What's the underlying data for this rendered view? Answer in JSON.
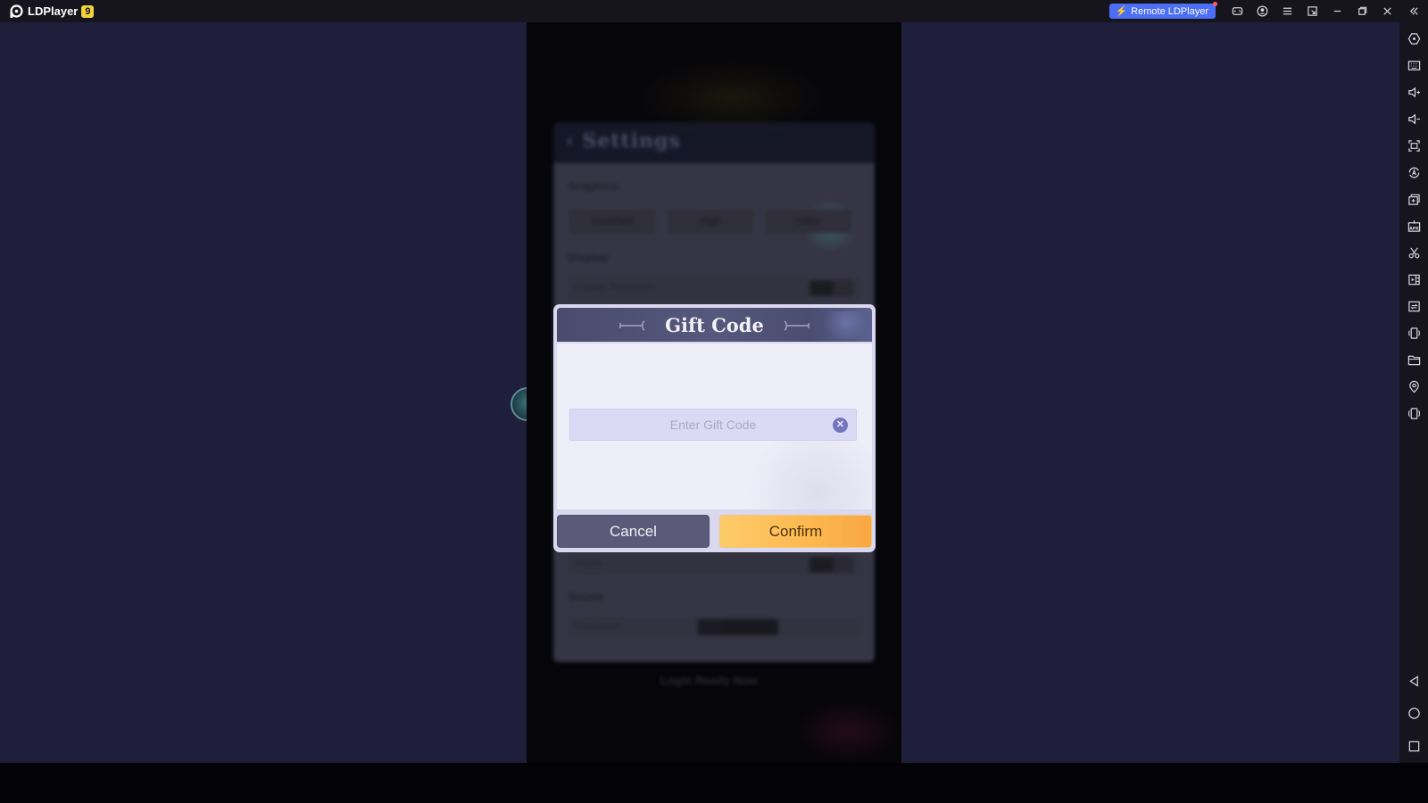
{
  "titlebar": {
    "app_name": "LDPlayer",
    "version_badge": "9",
    "remote_button_label": "Remote LDPlayer",
    "icons": [
      "gamepad-icon",
      "account-icon",
      "menu-icon",
      "sync-window-icon",
      "minimize-icon",
      "restore-icon",
      "close-icon",
      "collapse-sidebar-icon"
    ]
  },
  "sidebar": {
    "top_items": [
      {
        "name": "settings-icon",
        "label": "Settings"
      },
      {
        "name": "keyboard-icon",
        "label": "Keyboard mapping"
      },
      {
        "name": "volume-up-icon",
        "label": "Volume up"
      },
      {
        "name": "volume-down-icon",
        "label": "Volume down"
      },
      {
        "name": "screenshot-icon",
        "label": "Screenshot"
      },
      {
        "name": "auto-rotate-icon",
        "label": "Operation recorder"
      },
      {
        "name": "multi-instance-icon",
        "label": "Multi-instance"
      },
      {
        "name": "install-apk-icon",
        "label": "Install APK"
      },
      {
        "name": "scissors-icon",
        "label": "Cut"
      },
      {
        "name": "video-record-icon",
        "label": "Record video"
      },
      {
        "name": "sync-icon",
        "label": "Synchronizer"
      },
      {
        "name": "shake-icon",
        "label": "Shake"
      },
      {
        "name": "folder-icon",
        "label": "Shared folder"
      },
      {
        "name": "location-icon",
        "label": "Virtual location"
      },
      {
        "name": "rotate-icon",
        "label": "Rotate"
      }
    ],
    "nav_items": [
      {
        "name": "back-icon",
        "label": "Back"
      },
      {
        "name": "home-icon",
        "label": "Home"
      },
      {
        "name": "recents-icon",
        "label": "Recent apps"
      }
    ]
  },
  "background_settings": {
    "title": "Settings",
    "sections": [
      "Graphics",
      "Display",
      "Sound"
    ],
    "chips": [
      "Standard",
      "High",
      "Ultra"
    ],
    "rows": [
      "Display Resolution",
      "Frame",
      "Resolution"
    ],
    "footer_text": "Login Ready Now"
  },
  "dialog": {
    "title": "Gift Code",
    "input_value": "",
    "input_placeholder": "Enter Gift Code",
    "clear_symbol": "✕",
    "cancel_label": "Cancel",
    "confirm_label": "Confirm"
  },
  "colors": {
    "remote_button": "#4b6ef5",
    "version_badge": "#f4d33a",
    "dialog_header": "#4a4b6d",
    "cancel_button": "#5b5a78",
    "confirm_button": "#fdb84f",
    "clear_button": "#7274bd"
  }
}
